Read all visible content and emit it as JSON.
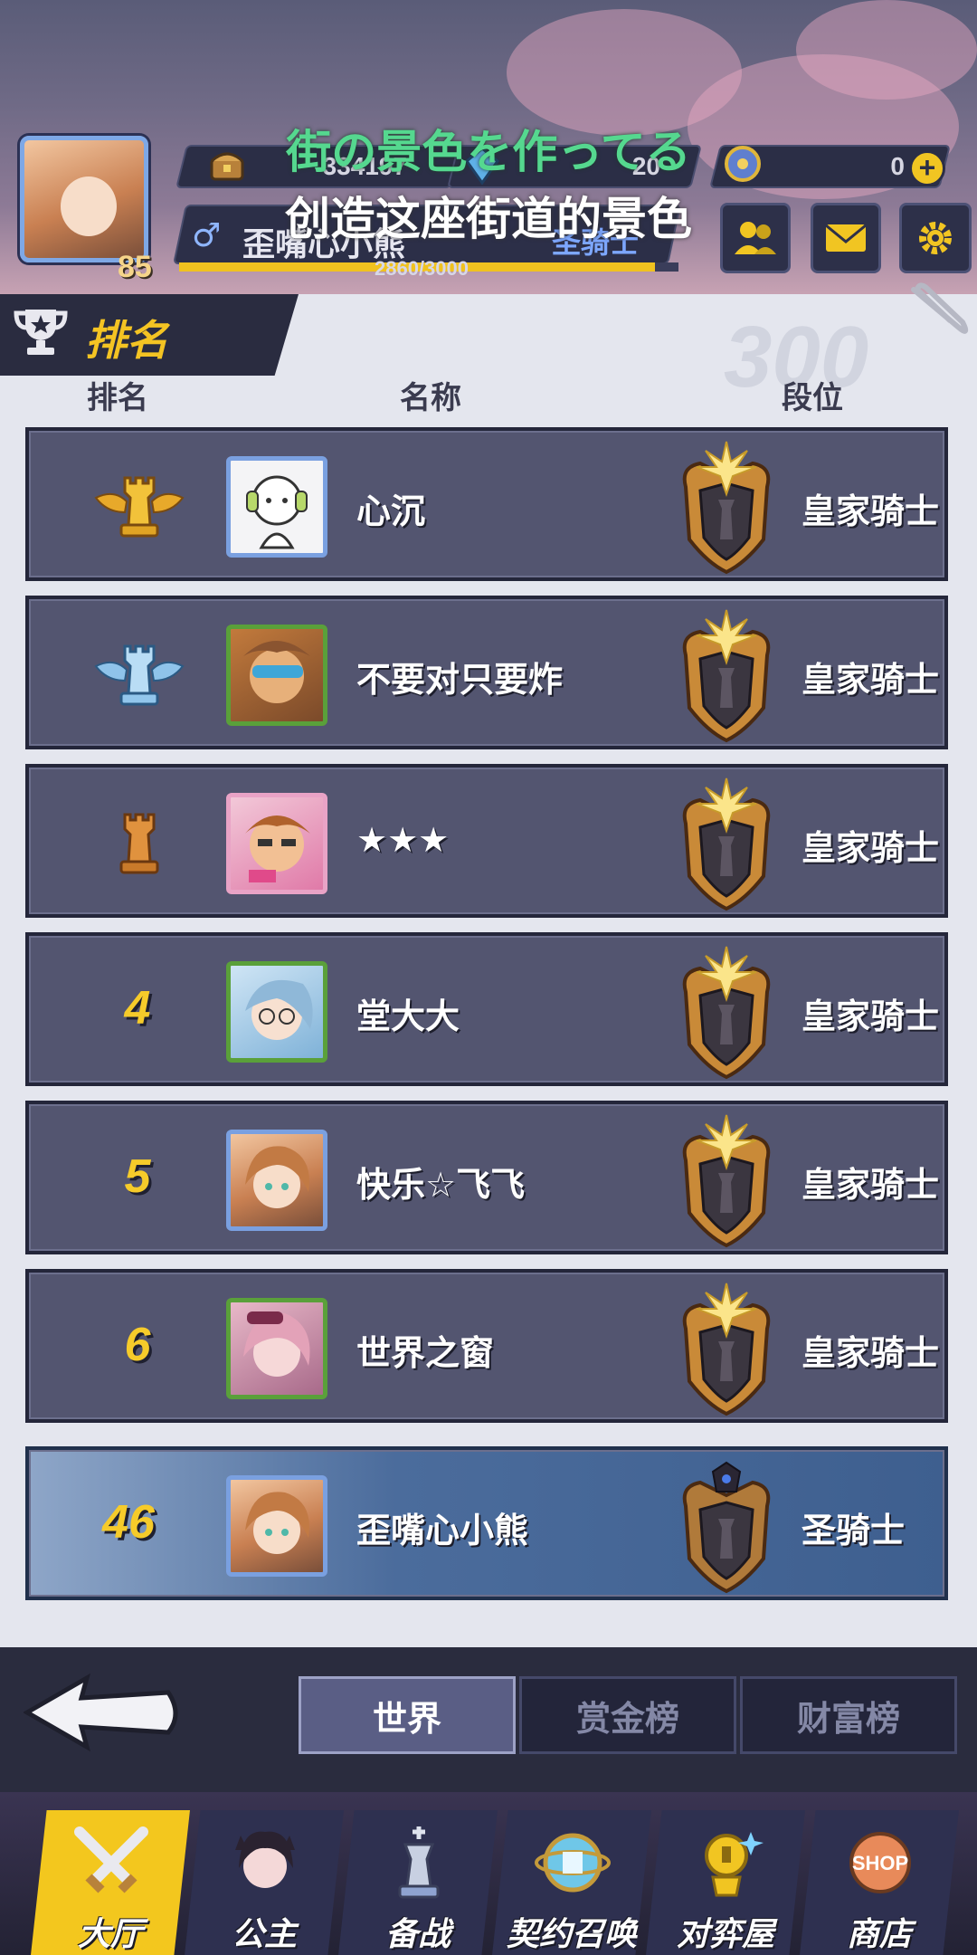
{
  "header": {
    "subtitle_jp": "街の景色を作ってる",
    "subtitle_cn": "创造这座街道的景色",
    "player_level": "85",
    "resources": [
      {
        "icon": "treasure-icon",
        "value": "334197"
      },
      {
        "icon": "gem-icon",
        "value": "20"
      },
      {
        "icon": "compass-coin-icon",
        "value": "0"
      }
    ],
    "gender_symbol": "♂",
    "player_name": "歪嘴心小熊",
    "player_rank": "圣骑士",
    "exp_text": "2860/3000",
    "exp_fraction": 0.953,
    "buttons": [
      "friends-icon",
      "mail-icon",
      "settings-icon"
    ]
  },
  "ranking": {
    "title": "排名",
    "watermark": "300",
    "columns": {
      "rank": "排名",
      "name": "名称",
      "tier": "段位"
    },
    "rows": [
      {
        "rank": "",
        "rank_icon": "gold-rook-icon",
        "name": "心沉",
        "tier": "皇家骑士"
      },
      {
        "rank": "",
        "rank_icon": "silver-rook-icon",
        "name": "不要对只要炸",
        "tier": "皇家骑士"
      },
      {
        "rank": "",
        "rank_icon": "bronze-rook-icon",
        "name": "★★★",
        "tier": "皇家骑士"
      },
      {
        "rank": "4",
        "rank_icon": "",
        "name": "堂大大",
        "tier": "皇家骑士"
      },
      {
        "rank": "5",
        "rank_icon": "",
        "name": "快乐☆飞飞",
        "tier": "皇家骑士"
      },
      {
        "rank": "6",
        "rank_icon": "",
        "name": "世界之窗",
        "tier": "皇家骑士"
      }
    ],
    "self_row": {
      "rank": "46",
      "name": "歪嘴心小熊",
      "tier": "圣骑士"
    }
  },
  "tabs": [
    {
      "label": "世界",
      "active": true
    },
    {
      "label": "赏金榜",
      "active": false
    },
    {
      "label": "财富榜",
      "active": false
    }
  ],
  "nav": [
    {
      "label": "大厅",
      "icon": "swords-icon",
      "active": true
    },
    {
      "label": "公主",
      "icon": "princess-icon",
      "active": false
    },
    {
      "label": "备战",
      "icon": "chess-king-icon",
      "active": false
    },
    {
      "label": "契约召唤",
      "icon": "summon-orb-icon",
      "active": false
    },
    {
      "label": "对弈屋",
      "icon": "duel-house-icon",
      "active": false
    },
    {
      "label": "商店",
      "icon": "shop-icon",
      "active": false
    }
  ],
  "colors": {
    "accent": "#f4c423",
    "panel": "#535570",
    "self_row": "#4b6c9c",
    "jp_subtitle": "#55d88f"
  }
}
